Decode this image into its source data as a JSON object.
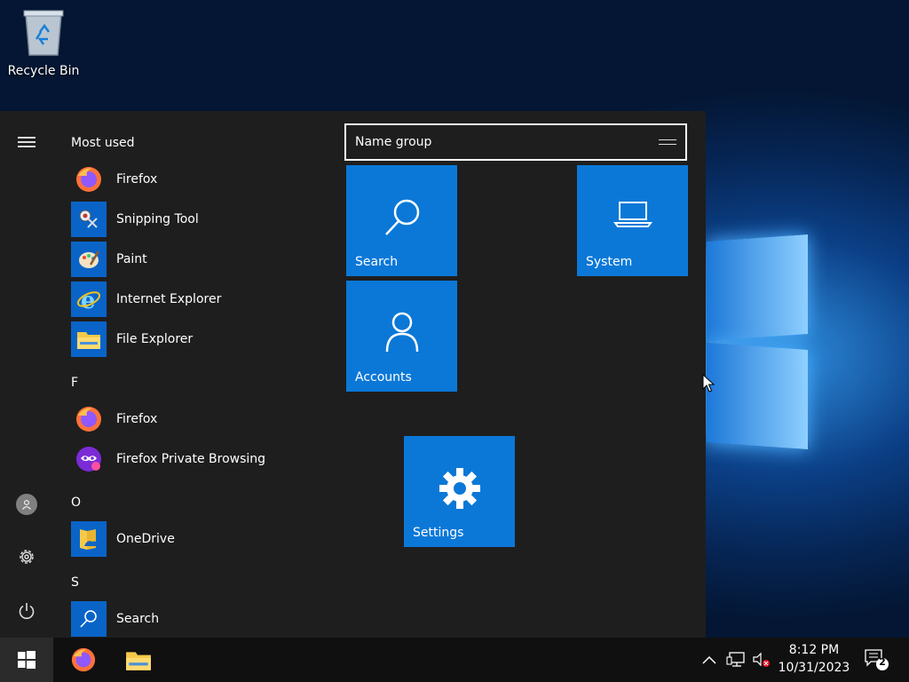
{
  "desktop": {
    "recycle_bin_label": "Recycle Bin"
  },
  "start_menu": {
    "sections": {
      "most_used": "Most used",
      "f": "F",
      "o": "O",
      "s": "S"
    },
    "apps": {
      "firefox_most_used": "Firefox",
      "snipping_tool": "Snipping Tool",
      "paint": "Paint",
      "internet_explorer": "Internet Explorer",
      "file_explorer": "File Explorer",
      "firefox": "Firefox",
      "firefox_private": "Firefox Private Browsing",
      "onedrive": "OneDrive",
      "search": "Search"
    },
    "group_name": "Name group",
    "tiles": {
      "search": "Search",
      "system": "System",
      "accounts": "Accounts",
      "settings": "Settings"
    }
  },
  "taskbar": {
    "time": "8:12 PM",
    "date": "10/31/2023",
    "notification_count": "2"
  },
  "colors": {
    "tile_blue": "#0b78d7",
    "menu_bg": "#1e1e1e",
    "taskbar_bg": "#101010"
  },
  "icons": {
    "start": "windows-logo-icon",
    "tray": [
      "chevron-up-icon",
      "network-icon",
      "volume-muted-icon",
      "action-center-icon"
    ]
  }
}
